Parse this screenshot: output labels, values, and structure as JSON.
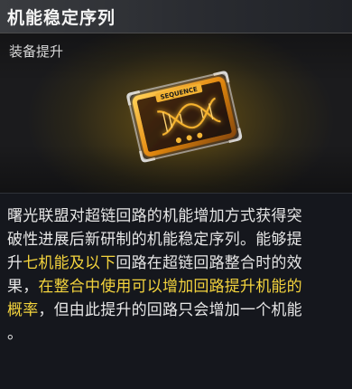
{
  "title": "机能稳定序列",
  "item_type": "装备提升",
  "item": {
    "icon": "sequence-card-icon",
    "card_label": "SEQUENCE"
  },
  "description": {
    "lines": [
      [
        {
          "t": "曙光联盟对超链回路的机能增加方式获得突"
        }
      ],
      [
        {
          "t": "破性进展后新研制的机能稳定序列。能够提"
        }
      ],
      [
        {
          "t": "升"
        },
        {
          "t": "七机能及以下",
          "hl": true
        },
        {
          "t": "回路在超链回路整合时的效"
        }
      ],
      [
        {
          "t": "果，"
        },
        {
          "t": "在整合中使用可以增加回路提升机能的",
          "hl": true
        }
      ],
      [
        {
          "t": "概率",
          "hl": true
        },
        {
          "t": "，但由此提升的回路只会增加一个机能"
        }
      ],
      [
        {
          "t": "。"
        }
      ]
    ]
  },
  "colors": {
    "highlight": "#f3d33d",
    "card_gold": "#f0a820",
    "background": "#15171d"
  }
}
